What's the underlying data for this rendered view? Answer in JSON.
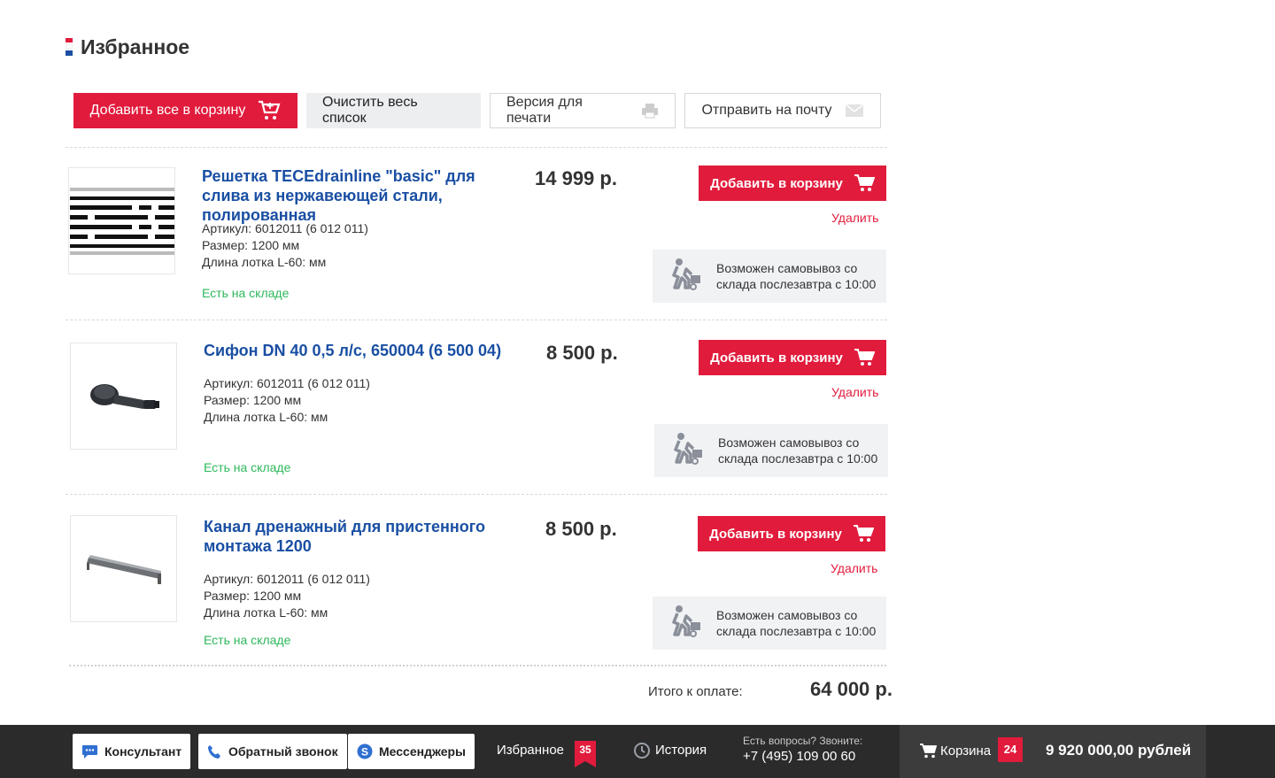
{
  "page": {
    "title": "Избранное",
    "brand_colors": {
      "red": "#e11b3c",
      "blue": "#1a4fa3",
      "green": "#2db85b"
    }
  },
  "toolbar": {
    "add_all": "Добавить все в корзину",
    "clear": "Очистить весь список",
    "print": "Версия для печати",
    "mail": "Отправить на почту"
  },
  "items": [
    {
      "title": "Решетка TECEdrainline \"basic\" для слива из нержавеющей стали, полированная",
      "article": "Артикул: 6012011 (6 012 011)",
      "size": "Размер: 1200 мм",
      "length": "Длина лотка L-60: мм",
      "stock": "Есть на складе",
      "price": "14 999 р.",
      "add_label": "Добавить в корзину",
      "delete_label": "Удалить",
      "pickup": "Возможен самовывоз со склада послезавтра с 10:00",
      "image_icon": "drain-grate-image"
    },
    {
      "title": "Сифон DN 40 0,5 л/с, 650004 (6 500 04)",
      "article": "Артикул: 6012011 (6 012 011)",
      "size": "Размер: 1200 мм",
      "length": "Длина лотка L-60: мм",
      "stock": "Есть на складе",
      "price": "8 500 р.",
      "add_label": "Добавить в корзину",
      "delete_label": "Удалить",
      "pickup": "Возможен самовывоз со склада послезавтра с 10:00",
      "image_icon": "siphon-image"
    },
    {
      "title": "Канал дренажный для пристенного монтажа 1200",
      "article": "Артикул: 6012011 (6 012 011)",
      "size": "Размер: 1200 мм",
      "length": "Длина лотка L-60: мм",
      "stock": "Есть на складе",
      "price": "8 500 р.",
      "add_label": "Добавить в корзину",
      "delete_label": "Удалить",
      "pickup": "Возможен самовывоз со склада послезавтра с 10:00",
      "image_icon": "drain-channel-image"
    }
  ],
  "total": {
    "label": "Итого к оплате:",
    "value": "64 000 р."
  },
  "footer": {
    "consultant": "Консультант",
    "callback": "Обратный звонок",
    "messengers": "Мессенджеры",
    "favorites": "Избранное",
    "favorites_count": "35",
    "history": "История",
    "questions": "Есть вопросы? Звоните:",
    "phone": "+7 (495) 109 00 60",
    "cart": "Корзина",
    "cart_count": "24",
    "cart_sum": "9 920 000,00 рублей"
  }
}
